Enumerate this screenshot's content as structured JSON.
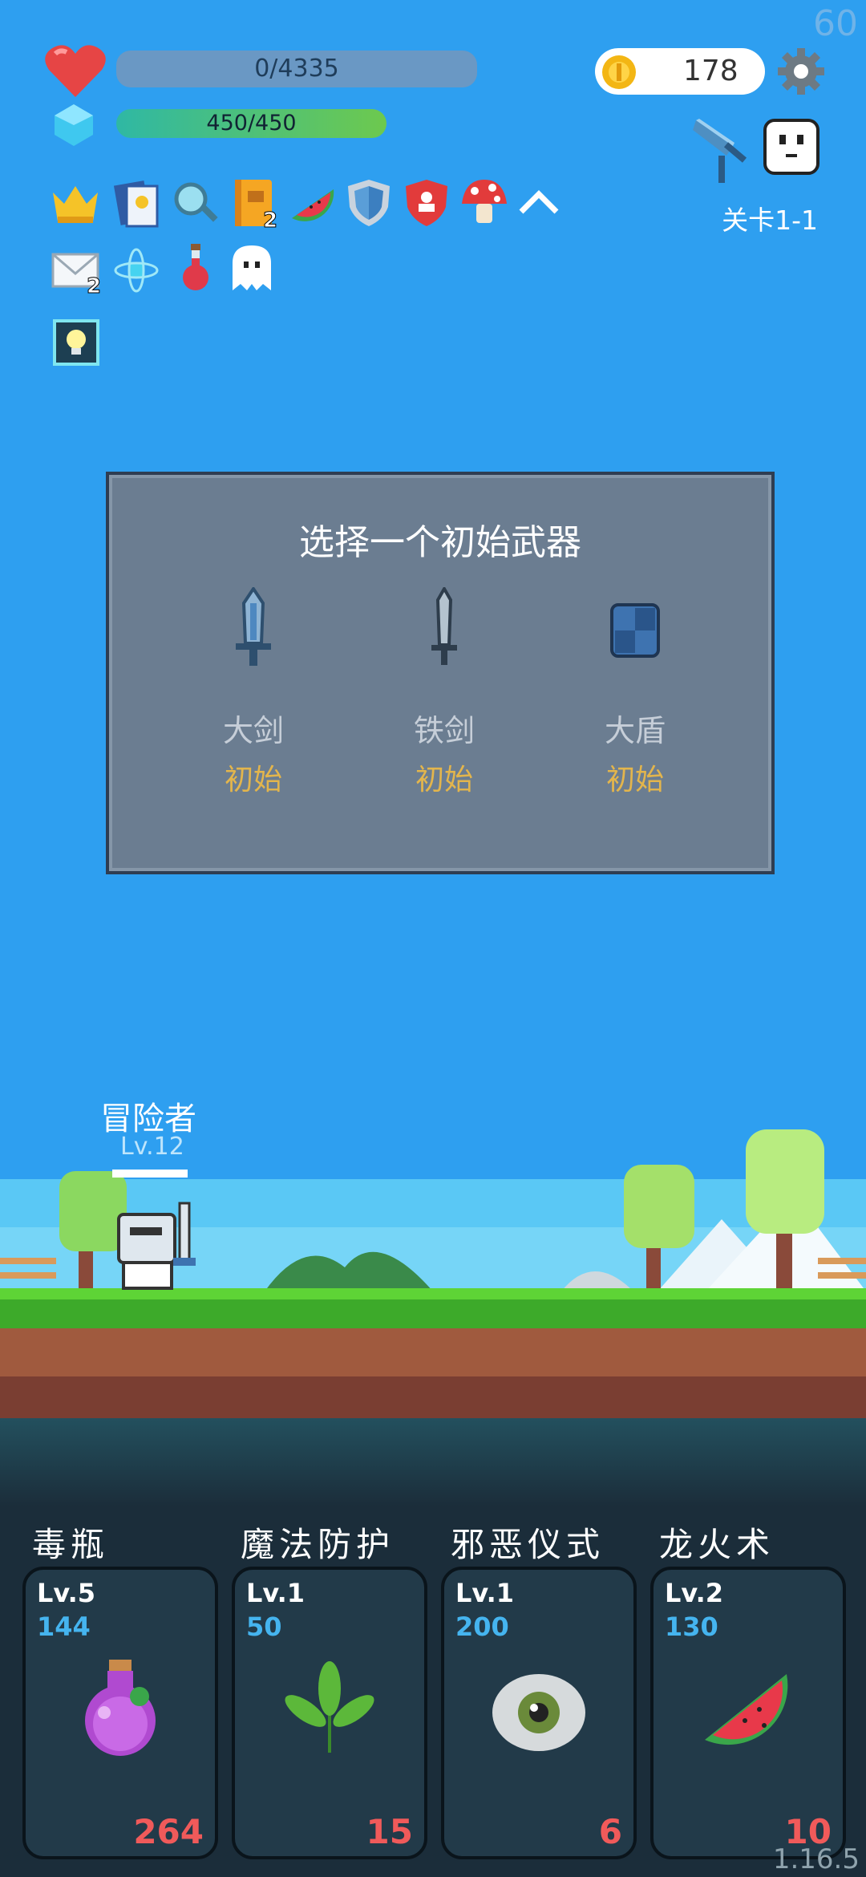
{
  "fps": "60",
  "version": "1.16.5",
  "stats": {
    "hp": "0/4335",
    "mp": "450/450"
  },
  "coins": "178",
  "stage": "关卡1-1",
  "buff_icons": [
    "crown-icon",
    "card-icon",
    "magnifier-icon",
    "book-icon",
    "watermelon-icon",
    "shield-icon",
    "red-shield-icon",
    "mushroom-icon",
    "chevron-up-icon"
  ],
  "buff_badges": {
    "book": "2",
    "mail": "2"
  },
  "row2_icons": [
    "mail-icon",
    "atom-icon",
    "potion-icon",
    "ghost-icon"
  ],
  "panel": {
    "title": "选择一个初始武器",
    "weapons": [
      {
        "name": "大剑",
        "tag": "初始",
        "icon": "great-sword-icon"
      },
      {
        "name": "铁剑",
        "tag": "初始",
        "icon": "iron-sword-icon"
      },
      {
        "name": "大盾",
        "tag": "初始",
        "icon": "large-shield-icon"
      }
    ]
  },
  "hero": {
    "name": "冒险者",
    "level": "Lv.12"
  },
  "skills": [
    {
      "title": "毒瓶",
      "level": "Lv.5",
      "cost": "144",
      "count": "264",
      "icon": "poison-bottle-icon"
    },
    {
      "title": "魔法防护",
      "level": "Lv.1",
      "cost": "50",
      "count": "15",
      "icon": "leaf-icon"
    },
    {
      "title": "邪恶仪式",
      "level": "Lv.1",
      "cost": "200",
      "count": "6",
      "icon": "eye-icon"
    },
    {
      "title": "龙火术",
      "level": "Lv.2",
      "cost": "130",
      "count": "10",
      "icon": "watermelon-icon"
    }
  ]
}
